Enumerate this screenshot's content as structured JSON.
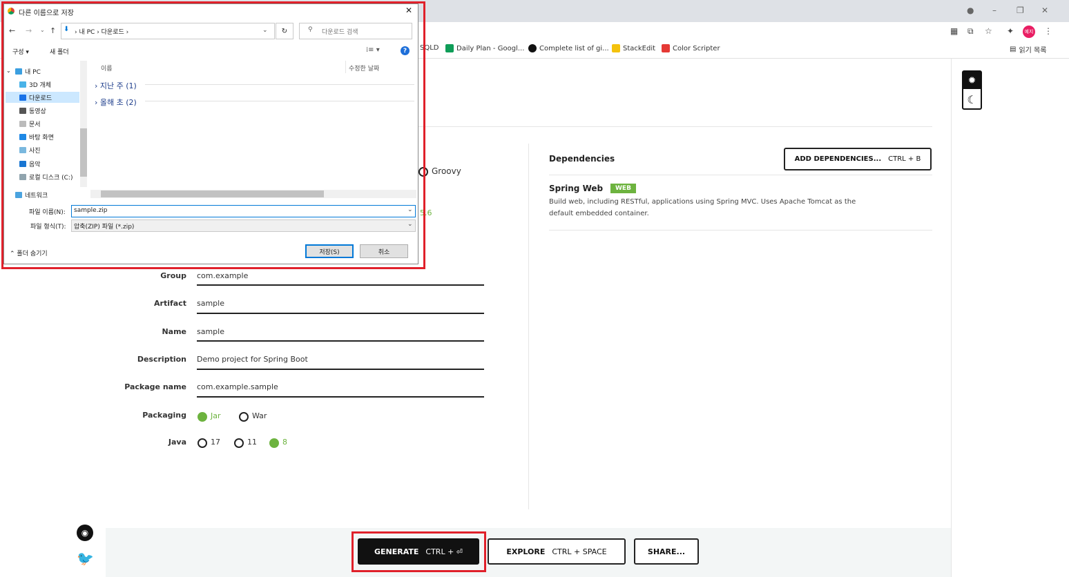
{
  "browser": {
    "bookmarks": [
      {
        "label": "SQLD",
        "color": "#1a73e8"
      },
      {
        "label": "Daily Plan - Googl...",
        "color": "#0f9d58"
      },
      {
        "label": "Complete list of gi...",
        "color": "#111111"
      },
      {
        "label": "StackEdit",
        "color": "#f4c20d"
      },
      {
        "label": "Color Scripter",
        "color": "#e53935"
      }
    ],
    "reading_list": "읽기 목록",
    "profile_badge": "예지"
  },
  "dialog": {
    "title": "다른 이름으로 저장",
    "breadcrumb": [
      "내 PC",
      "다운로드"
    ],
    "search_placeholder": "다운로드 검색",
    "toolbar_organize": "구성 ▾",
    "toolbar_new_folder": "새 폴더",
    "tree": [
      "내 PC",
      "3D 개체",
      "다운로드",
      "동영상",
      "문서",
      "바탕 화면",
      "사진",
      "음악",
      "로컬 디스크 (C:)",
      "네트워크"
    ],
    "columns": {
      "name": "이름",
      "modified": "수정한 날짜"
    },
    "groups": [
      "지난 주 (1)",
      "올해 초 (2)"
    ],
    "filename_label": "파일 이름(N):",
    "filename_value": "sample.zip",
    "filetype_label": "파일 형식(T):",
    "filetype_value": "압축(ZIP) 파일 (*.zip)",
    "hide_folders": "폴더 숨기기",
    "save_button": "저장(S)",
    "cancel_button": "취소"
  },
  "page": {
    "language_partial": "Groovy",
    "version_partial": "5.6",
    "fields": [
      {
        "label": "Group",
        "value": "com.example"
      },
      {
        "label": "Artifact",
        "value": "sample"
      },
      {
        "label": "Name",
        "value": "sample"
      },
      {
        "label": "Description",
        "value": "Demo project for Spring Boot"
      },
      {
        "label": "Package name",
        "value": "com.example.sample"
      }
    ],
    "packaging_label": "Packaging",
    "packaging_options": [
      "Jar",
      "War"
    ],
    "java_label": "Java",
    "java_options": [
      "17",
      "11",
      "8"
    ],
    "dependencies_title": "Dependencies",
    "add_dependencies": "ADD DEPENDENCIES...",
    "add_dependencies_kbd": "CTRL + B",
    "dependency": {
      "name": "Spring Web",
      "badge": "WEB",
      "desc1": "Build web, including RESTful, applications using Spring MVC. Uses Apache Tomcat as the",
      "desc2": "default embedded container."
    },
    "generate": "GENERATE",
    "generate_kbd": "CTRL + ⏎",
    "explore": "EXPLORE",
    "explore_kbd": "CTRL + SPACE",
    "share": "SHARE..."
  },
  "colors": {
    "accent": "#6db33f",
    "highlight": "#e0202a"
  }
}
